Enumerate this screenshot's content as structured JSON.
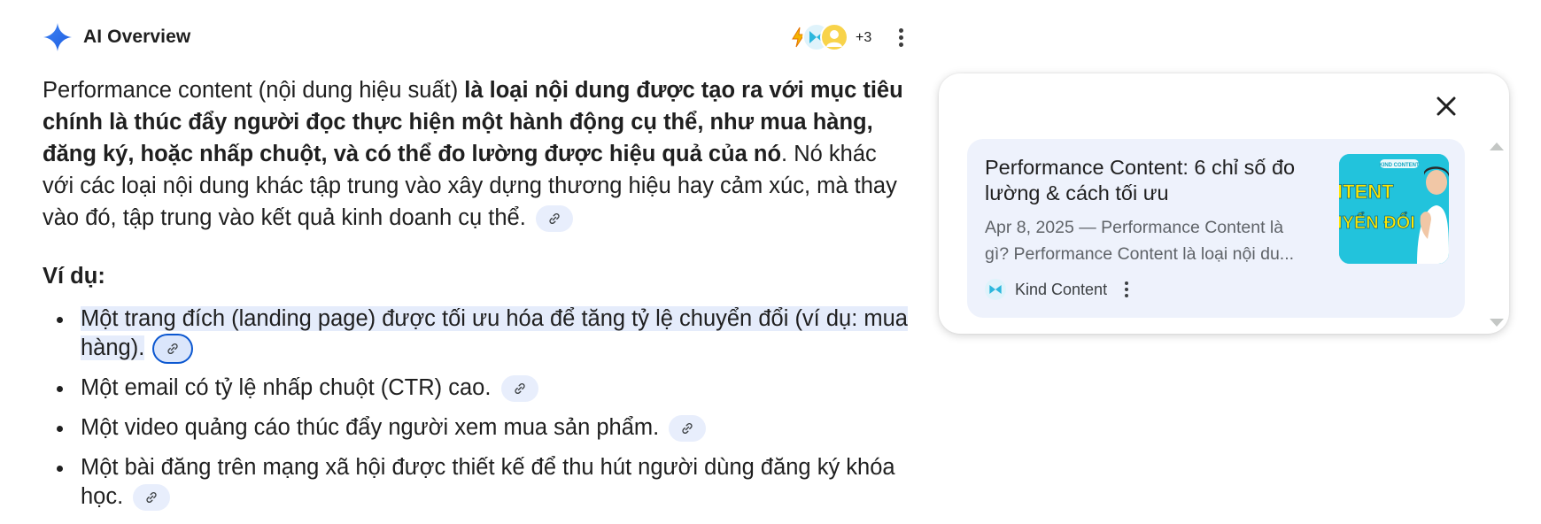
{
  "header": {
    "title": "AI Overview",
    "sparkle_icon": "sparkle-icon",
    "more_sources_count": "+3",
    "menu_icon": "more-vert-icon",
    "brand_color": "#1a73e8"
  },
  "main": {
    "intro_plain_1": "Performance content (nội dung hiệu suất) ",
    "intro_bold": "là loại nội dung được tạo ra với mục tiêu chính là thúc đẩy người đọc thực hiện một hành động cụ thể, như mua hàng, đăng ký, hoặc nhấp chuột, và có thể đo lường được hiệu quả của nó",
    "intro_plain_2": ". Nó khác với các loại nội dung khác tập trung vào xây dựng thương hiệu hay cảm xúc, mà thay vào đó, tập trung vào kết quả kinh doanh cụ thể.",
    "example_heading": "Ví dụ:",
    "examples": [
      "Một trang đích (landing page) được tối ưu hóa để tăng tỷ lệ chuyển đổi (ví dụ: mua hàng).",
      "Một email có tỷ lệ nhấp chuột (CTR) cao.",
      "Một video quảng cáo thúc đẩy người xem mua sản phẩm.",
      "Một bài đăng trên mạng xã hội được thiết kế để thu hút người dùng đăng ký khóa học."
    ],
    "citation_icon": "link-icon",
    "highlight_color": "#e5ecfb",
    "citation_bg": "#e8eefc"
  },
  "panel": {
    "close_icon": "close-icon",
    "card": {
      "title": "Performance Content: 6 chỉ số đo lường & cách tối ưu",
      "snippet_line1": "Apr 8, 2025 — Performance Content là",
      "snippet_line2": "gì? Performance Content là loại nội du...",
      "source_name": "Kind Content",
      "thumbnail_text_1": "ITENT",
      "thumbnail_text_2": "IYỂN ĐỔI",
      "thumbnail_badge": "KIND CONTENT"
    }
  }
}
